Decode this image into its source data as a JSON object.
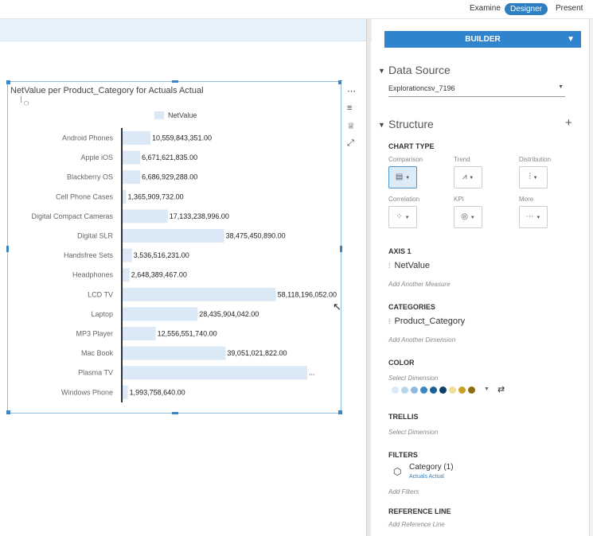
{
  "topbar": {
    "modes": [
      "Examine",
      "Designer",
      "Present"
    ]
  },
  "chart": {
    "title": "NetValue per Product_Category for Actuals Actual",
    "legend": "NetValue",
    "overflow_label": "..."
  },
  "chart_data": {
    "type": "bar",
    "orientation": "horizontal",
    "title": "NetValue per Product_Category for Actuals Actual",
    "series": [
      {
        "name": "NetValue",
        "color": "#dbe9f7"
      }
    ],
    "categories": [
      "Android Phones",
      "Apple iOS",
      "Blackberry OS",
      "Cell Phone Cases",
      "Digital Compact Cameras",
      "Digital SLR",
      "Handsfree Sets",
      "Headphones",
      "LCD TV",
      "Laptop",
      "MP3 Player",
      "Mac Book",
      "Plasma TV",
      "Windows Phone"
    ],
    "values": [
      10559843351,
      6671621835,
      6686929288,
      1365909732,
      17133238996,
      38475450890,
      3536516231,
      2648389467,
      58118196052,
      28435904042,
      12556551740,
      39051021822,
      70000000000,
      1993758640
    ],
    "value_labels": [
      "10,559,843,351.00",
      "6,671,621,835.00",
      "6,686,929,288.00",
      "1,365,909,732.00",
      "17,133,238,996.00",
      "38,475,450,890.00",
      "3,536,516,231.00",
      "2,648,389,467.00",
      "58,118,196,052.00",
      "28,435,904,042.00",
      "12,556,551,740.00",
      "39,051,021,822.00",
      "...",
      "1,993,758,640.00"
    ]
  },
  "toolbar": {
    "more": "⋯",
    "sort": "≡",
    "rank": "♕",
    "expand": "⤢"
  },
  "builder": {
    "button_label": "BUILDER",
    "data_source_heading": "Data Source",
    "data_source_value": "Explorationcsv_7196",
    "structure_heading": "Structure",
    "chart_type_label": "CHART TYPE",
    "chart_types": [
      "Comparison",
      "Trend",
      "Distribution",
      "Correlation",
      "KPI",
      "More"
    ],
    "axis_label": "AXIS 1",
    "axis_measure": "NetValue",
    "add_measure": "Add Another Measure",
    "categories_label": "CATEGORIES",
    "category_dimension": "Product_Category",
    "add_dimension": "Add Another Dimension",
    "color_label": "COLOR",
    "color_select": "Select Dimension",
    "palette": [
      "#dbe9f7",
      "#b8d5ee",
      "#8dbadf",
      "#3f87c2",
      "#1c5f96",
      "#0c3f69",
      "#f2de9a",
      "#c9a12a",
      "#8e6c10"
    ],
    "trellis_label": "TRELLIS",
    "trellis_select": "Select Dimension",
    "filters_label": "FILTERS",
    "filter_name": "Category (1)",
    "filter_value": "Actuals Actual",
    "add_filters": "Add Filters",
    "reference_label": "REFERENCE LINE",
    "add_reference": "Add Reference Line"
  }
}
